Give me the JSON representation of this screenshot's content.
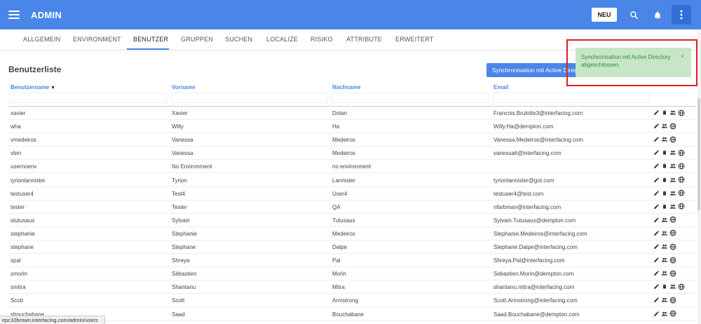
{
  "app": {
    "title": "ADMIN",
    "new_label": "NEU"
  },
  "tabs": [
    "ALLGEMEIN",
    "ENVIRONMENT",
    "BENUTZER",
    "GRUPPEN",
    "SUCHEN",
    "LOCALIZE",
    "RISIKO",
    "ATTRIBUTE",
    "ERWEITERT"
  ],
  "active_tab": "BENUTZER",
  "section_title": "Benutzerliste",
  "sync_button": "Synchronisation mit Active Directory",
  "toast": {
    "message": "Synchronisation mit Active Directory abgeschlossen.",
    "close": "×"
  },
  "columns": {
    "username": "Benutzername",
    "firstname": "Vorname",
    "lastname": "Nachname",
    "email": "Email"
  },
  "sort_indicator": "▼",
  "rows": [
    {
      "username": "xavier",
      "firstname": "Xavier",
      "lastname": "Dolan",
      "email": "Francois.Brulotte3@interfacing.com",
      "deletable": true
    },
    {
      "username": "wha",
      "firstname": "Willy",
      "lastname": "Ha",
      "email": "Willy.Ha@dempton.com",
      "deletable": false
    },
    {
      "username": "vmedeiros",
      "firstname": "Vanessa",
      "lastname": "Medeiros",
      "email": "Vanessa.Medeiros@interfacing.com",
      "deletable": false
    },
    {
      "username": "vbm",
      "firstname": "Vanessa",
      "lastname": "Medeiros",
      "email": "vanessa6@interfacing.com",
      "deletable": true
    },
    {
      "username": "usernoenv",
      "firstname": "No Environment",
      "lastname": "no environment",
      "email": "",
      "deletable": true
    },
    {
      "username": "tyrionlannister",
      "firstname": "Tyrion",
      "lastname": "Lannister",
      "email": "tyrionlannister@got.com",
      "deletable": true
    },
    {
      "username": "testuser4",
      "firstname": "Test4",
      "lastname": "User4",
      "email": "testuser4@test.com",
      "deletable": true
    },
    {
      "username": "tester",
      "firstname": "Tester",
      "lastname": "QA",
      "email": "nfarbman@interfacing.com",
      "deletable": true
    },
    {
      "username": "stutusaus",
      "firstname": "Sylvain",
      "lastname": "Tutusaus",
      "email": "Sylvain.Tutusaus@dempton.com",
      "deletable": false
    },
    {
      "username": "stephanie",
      "firstname": "Stephanie",
      "lastname": "Medeiros",
      "email": "Stephanie.Medeiros@interfacing.com",
      "deletable": false
    },
    {
      "username": "stephane",
      "firstname": "Stephane",
      "lastname": "Dalpe",
      "email": "Stephane.Dalpe@interfacing.com",
      "deletable": false
    },
    {
      "username": "spal",
      "firstname": "Shreya",
      "lastname": "Pal",
      "email": "Shreya.Pal@interfacing.com",
      "deletable": false
    },
    {
      "username": "smorin",
      "firstname": "Sébastien",
      "lastname": "Morin",
      "email": "Sebastien.Morin@dempton.com",
      "deletable": false
    },
    {
      "username": "smitra",
      "firstname": "Shantanu",
      "lastname": "Mitra",
      "email": "shantanu.mitra@interfacing.com",
      "deletable": true
    },
    {
      "username": "Scott",
      "firstname": "Scott",
      "lastname": "Armstrong",
      "email": "Scott.Armstrong@interfacing.com",
      "deletable": false
    },
    {
      "username": "sbouchabane",
      "firstname": "Saad",
      "lastname": "Bouchabane",
      "email": "Saad.Bouchabane@dempton.com",
      "deletable": false
    }
  ],
  "status_url": "epc10brown.interfacing.com/admin/users",
  "icons": [
    "menu-icon",
    "search-icon",
    "bell-icon",
    "more-vert-icon",
    "edit-icon",
    "delete-icon",
    "group-icon",
    "globe-icon"
  ],
  "colors": {
    "primary": "#4a86e8",
    "toast_bg": "#c7e6c7",
    "toast_text": "#3a8a3a",
    "highlight": "#e02020"
  }
}
